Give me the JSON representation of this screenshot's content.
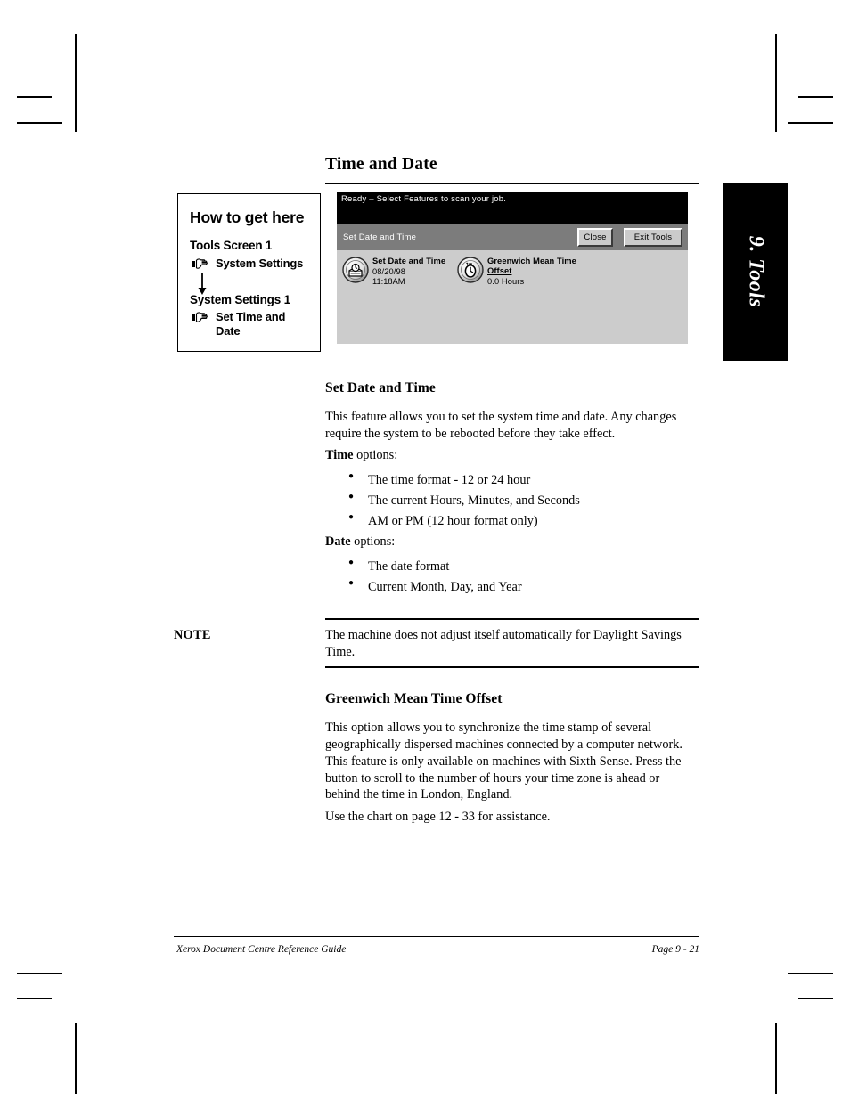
{
  "chapter_tab": {
    "label": "9. Tools"
  },
  "page_title": "Time and Date",
  "howto": {
    "title": "How to get here",
    "step1_heading": "Tools Screen 1",
    "step1_item": "System Settings",
    "step2_heading": "System Settings 1",
    "step2_item": "Set Time and Date"
  },
  "ui_panel": {
    "status_text": "Ready –  Select Features to scan your job.",
    "titlebar_text": "Set Date and Time",
    "close_label": "Close",
    "exit_label": "Exit Tools",
    "features": [
      {
        "icon": "clock-calendar-icon",
        "label": "Set Date and Time",
        "value1": "08/20/98",
        "value2": "11:18AM"
      },
      {
        "icon": "stopwatch-icon",
        "label": "Greenwich Mean Time Offset",
        "label_line1": "Greenwich Mean Time",
        "label_line2": "Offset",
        "value1": "0.0 Hours"
      }
    ],
    "colors": {
      "status_bg": "#000000",
      "titlebar_bg": "#7c7c7c",
      "body_bg": "#cccccc",
      "button_face": "#cbcbcb"
    }
  },
  "sections": {
    "set_date_time": {
      "heading": "Set Date and Time",
      "paragraph": "This feature allows you to set the system time and date. Any changes require the system to be rebooted before they take effect.",
      "time_lead_bold": "Time",
      "time_lead_rest": " options:",
      "time_options": [
        "The time format - 12 or 24 hour",
        "The current Hours, Minutes, and Seconds",
        "AM or PM (12 hour format only)"
      ],
      "date_lead_bold": "Date",
      "date_lead_rest": " options:",
      "date_options": [
        "The date format",
        "Current Month, Day, and Year"
      ]
    },
    "note": {
      "label": "NOTE",
      "text": "The machine does not adjust itself automatically for Daylight Savings Time."
    },
    "gmt_offset": {
      "heading": "Greenwich Mean Time Offset",
      "paragraph": "This option allows you to synchronize the time stamp of several geographically dispersed machines connected by a computer network. This feature is only available on machines with Sixth Sense. Press the button to scroll to the number of hours your time zone is ahead or behind the time in London, England.",
      "reference": "Use the chart on page 12 - 33 for assistance."
    }
  },
  "footer": {
    "left": "Xerox Document Centre Reference Guide",
    "right": "Page 9 - 21"
  }
}
